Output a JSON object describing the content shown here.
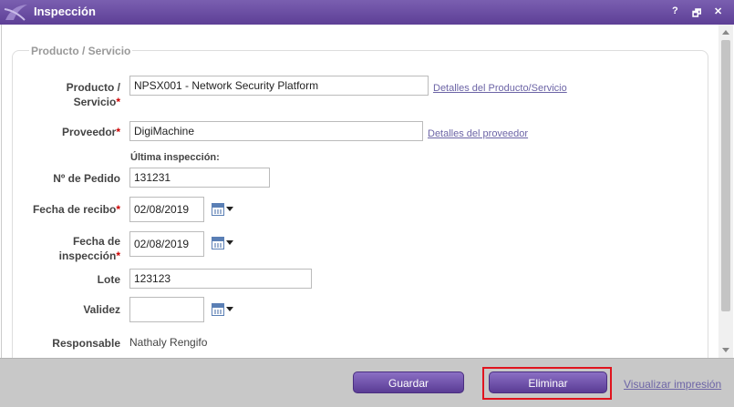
{
  "window": {
    "title": "Inspección",
    "help_label": "?",
    "restore_label": "🗗",
    "close_label": "✕"
  },
  "section": {
    "legend": "Producto / Servicio"
  },
  "form": {
    "producto_label_1": "Producto /",
    "producto_label_2": "Servicio",
    "producto_value": "NPSX001 - Network Security Platform",
    "producto_link": "Detalles del Producto/Servicio",
    "proveedor_label": "Proveedor",
    "proveedor_value": "DigiMachine",
    "proveedor_link": "Detalles del proveedor",
    "ultima_inspeccion_label": "Última inspección:",
    "pedido_label": "Nº de Pedido",
    "pedido_value": "131231",
    "recibo_label": "Fecha de recibo",
    "recibo_value": "02/08/2019",
    "inspeccion_label_1": "Fecha de",
    "inspeccion_label_2": "inspección",
    "inspeccion_value": "02/08/2019",
    "lote_label": "Lote",
    "lote_value": "123123",
    "validez_label": "Validez",
    "validez_value": "",
    "responsable_label": "Responsable",
    "responsable_value": "Nathaly Rengifo",
    "required_mark": "*"
  },
  "footer": {
    "guardar_label": "Guardar",
    "eliminar_label": "Eliminar",
    "visualizar_label": "Visualizar impresión"
  },
  "colors": {
    "titlebar": "#5d3f96",
    "button": "#6a4ca8",
    "link": "#6c64a6",
    "required": "#cc0000",
    "highlight": "#e0141e"
  }
}
